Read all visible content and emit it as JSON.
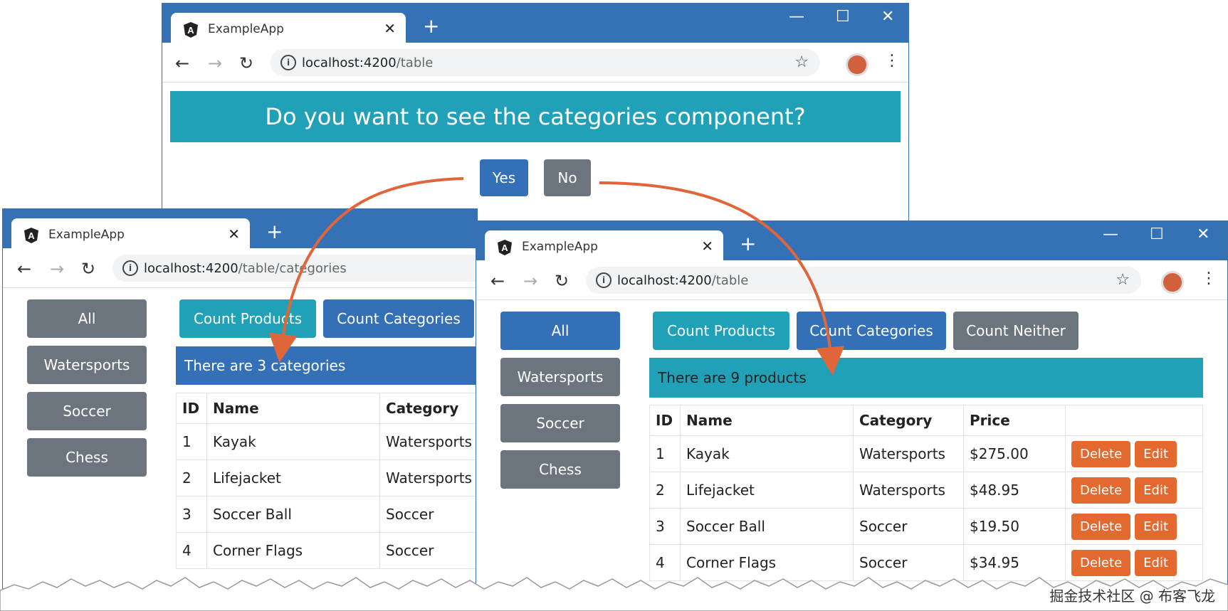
{
  "top_window": {
    "tab_title": "ExampleApp",
    "url_host": "localhost:4200",
    "url_path": "/table",
    "question": "Do you want to see the categories component?",
    "yes_label": "Yes",
    "no_label": "No"
  },
  "left_window": {
    "tab_title": "ExampleApp",
    "url_host": "localhost:4200",
    "url_path": "/table/categories",
    "sidebar": [
      "All",
      "Watersports",
      "Soccer",
      "Chess"
    ],
    "buttons": {
      "count_products": "Count Products",
      "count_categories": "Count Categories"
    },
    "banner": "There are 3 categories",
    "columns": [
      "ID",
      "Name",
      "Category"
    ],
    "rows": [
      [
        "1",
        "Kayak",
        "Watersports"
      ],
      [
        "2",
        "Lifejacket",
        "Watersports"
      ],
      [
        "3",
        "Soccer Ball",
        "Soccer"
      ],
      [
        "4",
        "Corner Flags",
        "Soccer"
      ]
    ]
  },
  "right_window": {
    "tab_title": "ExampleApp",
    "url_host": "localhost:4200",
    "url_path": "/table",
    "sidebar": [
      "All",
      "Watersports",
      "Soccer",
      "Chess"
    ],
    "buttons": {
      "count_products": "Count Products",
      "count_categories": "Count Categories",
      "count_neither": "Count Neither"
    },
    "banner": "There are 9 products",
    "columns": [
      "ID",
      "Name",
      "Category",
      "Price",
      ""
    ],
    "rows": [
      [
        "1",
        "Kayak",
        "Watersports",
        "$275.00"
      ],
      [
        "2",
        "Lifejacket",
        "Watersports",
        "$48.95"
      ],
      [
        "3",
        "Soccer Ball",
        "Soccer",
        "$19.50"
      ],
      [
        "4",
        "Corner Flags",
        "Soccer",
        "$34.95"
      ]
    ],
    "delete_label": "Delete",
    "edit_label": "Edit"
  },
  "watermark": "掘金技术社区 @ 布客飞龙",
  "colors": {
    "primary": "#3470b8",
    "secondary": "#6c757d",
    "info": "#21a1b7",
    "danger": "#e3692f",
    "arrow": "#e0663a"
  }
}
